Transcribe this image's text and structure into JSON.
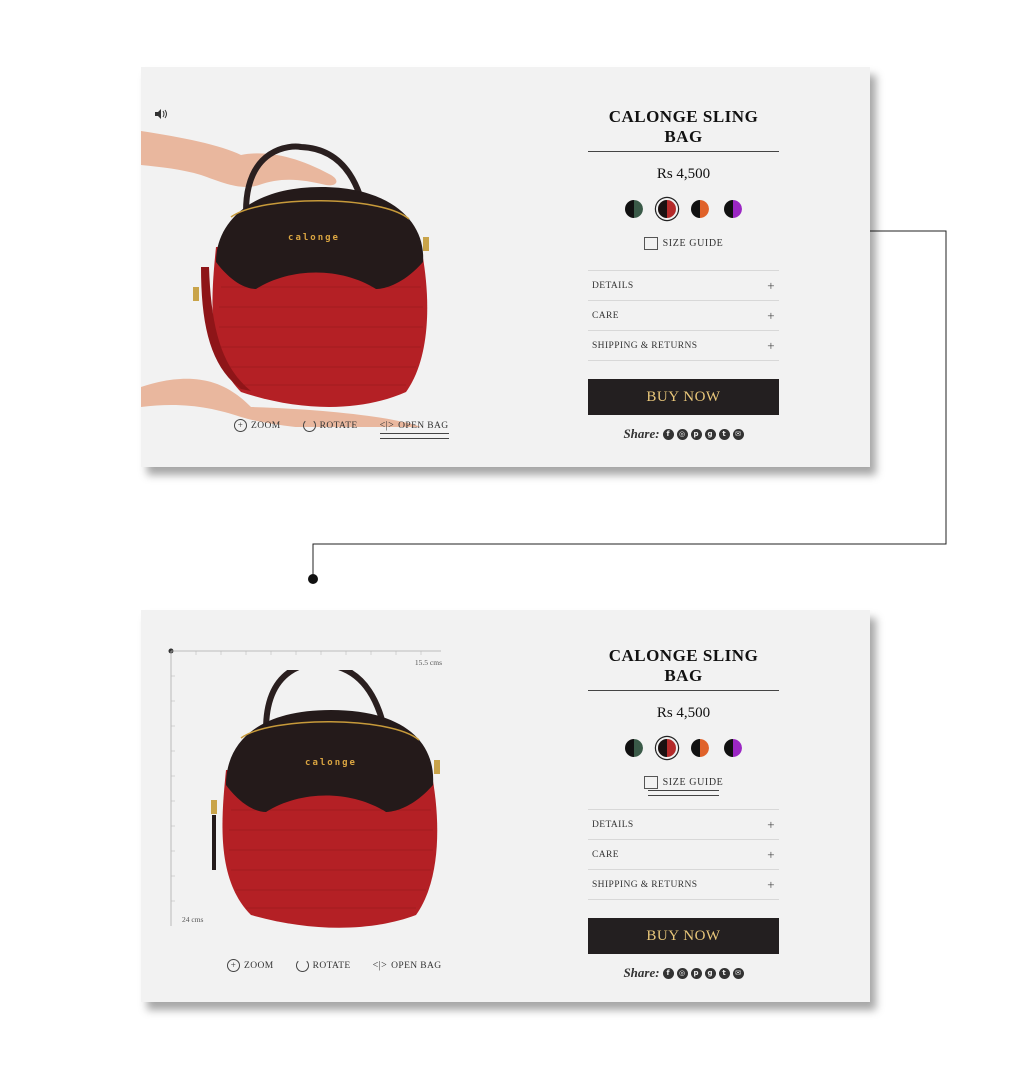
{
  "views": [
    {
      "title": "CALONGE SLING BAG",
      "price": "Rs 4,500",
      "brand_label": "calonge",
      "size_guide": "SIZE GUIDE",
      "accordion": [
        {
          "label": "DETAILS",
          "symbol": "+"
        },
        {
          "label": "CARE",
          "symbol": "+"
        },
        {
          "label": "SHIPPING & RETURNS",
          "symbol": "+"
        }
      ],
      "buy_label": "BUY NOW",
      "share_label": "Share:",
      "controls": {
        "zoom": "ZOOM",
        "rotate": "ROTATE",
        "open_bag": "OPEN BAG"
      },
      "active_control": "open_bag"
    },
    {
      "title": "CALONGE SLING BAG",
      "price": "Rs 4,500",
      "brand_label": "calonge",
      "size_guide": "SIZE GUIDE",
      "accordion": [
        {
          "label": "DETAILS",
          "symbol": "+"
        },
        {
          "label": "CARE",
          "symbol": "+"
        },
        {
          "label": "SHIPPING & RETURNS",
          "symbol": "+"
        }
      ],
      "buy_label": "BUY NOW",
      "share_label": "Share:",
      "controls": {
        "zoom": "ZOOM",
        "rotate": "ROTATE",
        "open_bag": "OPEN BAG"
      },
      "measure_width": "15.5 cms",
      "measure_height": "24 cms",
      "active_control": "size_guide"
    }
  ],
  "swatches": [
    {
      "left": "#111111",
      "right": "#3a5a48",
      "selected": false
    },
    {
      "left": "#1a1111",
      "right": "#b52a2a",
      "selected": true
    },
    {
      "left": "#111111",
      "right": "#e0622a",
      "selected": false
    },
    {
      "left": "#111111",
      "right": "#9b27c4",
      "selected": false
    }
  ],
  "share_icons": [
    "facebook-icon",
    "instagram-icon",
    "pinterest-icon",
    "google-plus-icon",
    "twitter-icon",
    "email-icon"
  ],
  "colors": {
    "card_bg": "#f2f2f2",
    "buy_bg": "#231f20",
    "buy_text": "#e9c77a",
    "bag_red": "#b42025",
    "bag_black": "#241a1a"
  }
}
